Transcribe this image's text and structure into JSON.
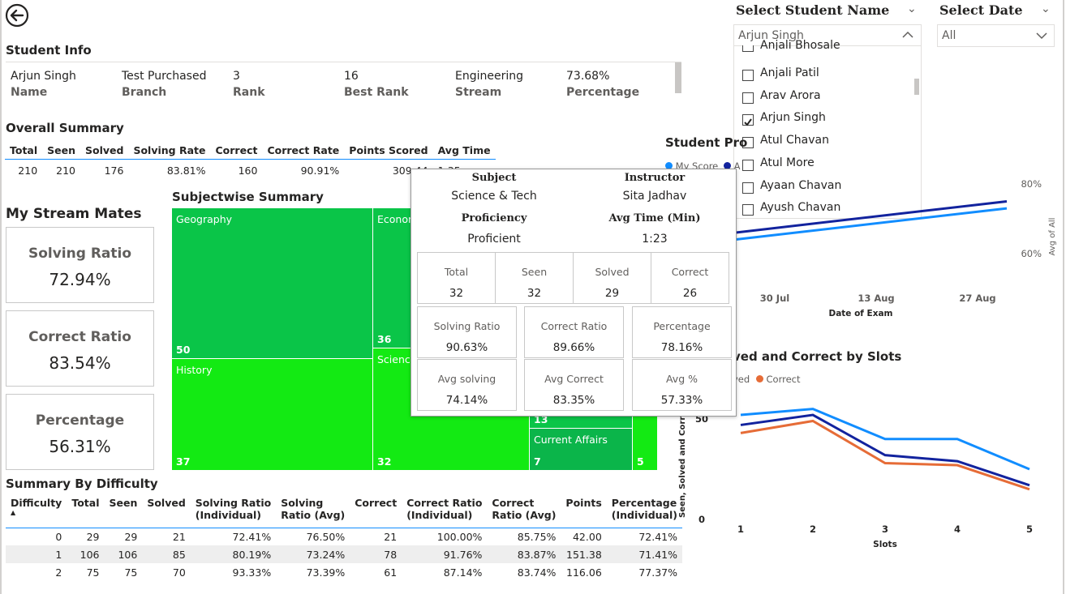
{
  "student_info": {
    "title": "Student Info",
    "row": [
      {
        "value": "Arjun Singh",
        "label": "Name"
      },
      {
        "value": "Test Purchased",
        "label": "Branch"
      },
      {
        "value": "3",
        "label": "Rank"
      },
      {
        "value": "16",
        "label": "Best Rank"
      },
      {
        "value": "Engineering",
        "label": "Stream"
      },
      {
        "value": "73.68%",
        "label": "Percentage"
      }
    ]
  },
  "overall_summary": {
    "title": "Overall Summary",
    "headers": [
      "Total",
      "Seen",
      "Solved",
      "Solving Rate",
      "Correct",
      "Correct Rate",
      "Points Scored",
      "Avg Time"
    ],
    "row": [
      "210",
      "210",
      "176",
      "83.81%",
      "160",
      "90.91%",
      "309.44",
      "1:35"
    ]
  },
  "stream_mates": {
    "title": "My Stream Mates",
    "cards": [
      {
        "label": "Solving Ratio",
        "value": "72.94%"
      },
      {
        "label": "Correct Ratio",
        "value": "83.54%"
      },
      {
        "label": "Percentage",
        "value": "56.31%"
      }
    ]
  },
  "subjectwise": {
    "title": "Subjectwise Summary",
    "tiles": [
      {
        "name": "Geography",
        "count": "50"
      },
      {
        "name": "Econom",
        "count": "36"
      },
      {
        "name": "History",
        "count": "37"
      },
      {
        "name": "Science",
        "count": "32"
      },
      {
        "name": "",
        "count": "13"
      },
      {
        "name": "Current Affairs",
        "count": "7"
      },
      {
        "name": "",
        "count": "5"
      }
    ]
  },
  "difficulty": {
    "title": "Summary By Difficulty",
    "headers": [
      [
        "Difficulty",
        ""
      ],
      [
        "Total",
        ""
      ],
      [
        "Seen",
        ""
      ],
      [
        "Solved",
        ""
      ],
      [
        "Solving Ratio",
        "(Individual)"
      ],
      [
        "Solving",
        "Ratio (Avg)"
      ],
      [
        "Correct",
        ""
      ],
      [
        "Correct Ratio",
        "(Individual)"
      ],
      [
        "Correct",
        "Ratio (Avg)"
      ],
      [
        "Points",
        ""
      ],
      [
        "Percentage",
        "(Individual)"
      ]
    ],
    "rows": [
      [
        "0",
        "29",
        "29",
        "21",
        "72.41%",
        "76.50%",
        "21",
        "100.00%",
        "85.75%",
        "42.00",
        "72.41%"
      ],
      [
        "1",
        "106",
        "106",
        "85",
        "80.19%",
        "73.24%",
        "78",
        "91.76%",
        "83.87%",
        "151.38",
        "71.41%"
      ],
      [
        "2",
        "75",
        "75",
        "70",
        "93.33%",
        "73.39%",
        "61",
        "87.14%",
        "83.74%",
        "116.06",
        "77.37%"
      ]
    ]
  },
  "tooltip": {
    "subject_label": "Subject",
    "subject": "Science & Tech",
    "instructor_label": "Instructor",
    "instructor": "Sita Jadhav",
    "proficiency_label": "Proficiency",
    "proficiency": "Proficient",
    "avgtime_label": "Avg Time (Min)",
    "avgtime": "1:23",
    "row1": [
      {
        "h": "Total",
        "v": "32"
      },
      {
        "h": "Seen",
        "v": "32"
      },
      {
        "h": "Solved",
        "v": "29"
      },
      {
        "h": "Correct",
        "v": "26"
      }
    ],
    "row2": [
      {
        "h": "Solving Ratio",
        "v": "90.63%"
      },
      {
        "h": "Correct Ratio",
        "v": "89.66%"
      },
      {
        "h": "Percentage",
        "v": "78.16%"
      }
    ],
    "row3": [
      {
        "h": "Avg solving",
        "v": "74.14%"
      },
      {
        "h": "Avg Correct",
        "v": "83.35%"
      },
      {
        "h": "Avg %",
        "v": "57.33%"
      }
    ]
  },
  "filters": {
    "student_title": "Select Student Name",
    "student_selected": "Arjun Singh",
    "date_title": "Select Date",
    "date_selected": "All",
    "options": [
      {
        "name": "Anjali Bhosale",
        "checked": false
      },
      {
        "name": "Anjali Patil",
        "checked": false
      },
      {
        "name": "Arav Arora",
        "checked": false
      },
      {
        "name": "Arjun Singh",
        "checked": true
      },
      {
        "name": "Atul Chavan",
        "checked": false
      },
      {
        "name": "Atul More",
        "checked": false
      },
      {
        "name": "Ayaan Chavan",
        "checked": false
      },
      {
        "name": "Ayush Chavan",
        "checked": false
      }
    ]
  },
  "progress_chart": {
    "title_visible": "Student Pro",
    "legend": [
      "My Score",
      "A"
    ],
    "x_ticks": [
      "30 Jul",
      "13 Aug",
      "27 Aug"
    ],
    "x_label": "Date of Exam",
    "y_ticks": [
      "80%",
      "60%"
    ],
    "y_label": "Avg of All",
    "colors": {
      "my_score": "#118dff",
      "avg": "#12239e"
    }
  },
  "slots_chart": {
    "title_visible": "ved and Correct by Slots",
    "legend": [
      "ved",
      "Correct"
    ],
    "x_label": "Slots",
    "y_label": "Seen, Solved and Correc",
    "y_ticks": [
      "50",
      "0"
    ],
    "colors": {
      "seen": "#118dff",
      "solved": "#12239e",
      "correct": "#e66c37"
    }
  },
  "chart_data": [
    {
      "type": "line",
      "x": [
        "30 Jul",
        "27 Aug"
      ],
      "series": [
        {
          "name": "My Score",
          "values": [
            0.64,
            0.73
          ]
        },
        {
          "values": [
            0.66,
            0.75
          ]
        }
      ],
      "ylabel": "Avg of All"
    },
    {
      "type": "line",
      "x": [
        "1",
        "2",
        "3",
        "4",
        "5"
      ],
      "xlabel": "Slots",
      "ylabel": "Seen, Solved and Correc",
      "ylim": [
        0,
        75
      ],
      "series": [
        {
          "values": [
            52,
            55,
            40,
            40,
            25
          ]
        },
        {
          "values": [
            47,
            52,
            32,
            29,
            17
          ]
        },
        {
          "name": "Correct",
          "values": [
            43,
            49,
            28,
            27,
            15
          ]
        }
      ]
    }
  ]
}
